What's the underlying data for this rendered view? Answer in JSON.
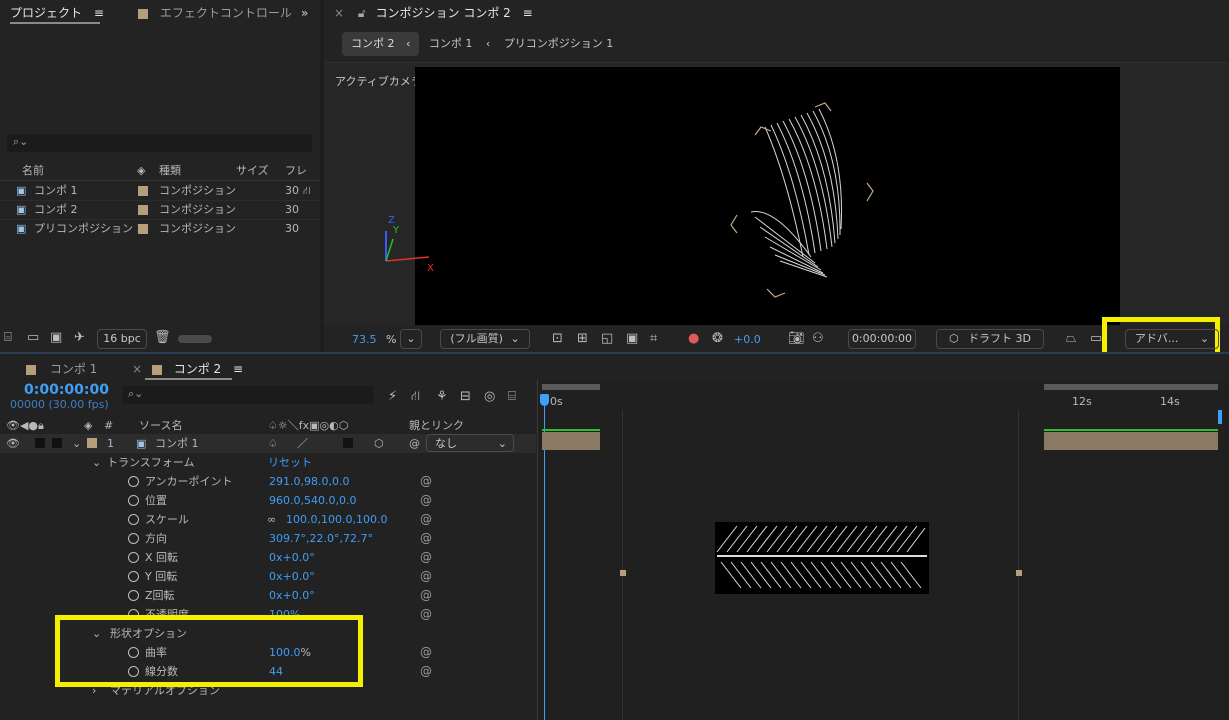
{
  "project_panel": {
    "tab_project": "プロジェクト",
    "tab_effects": "エフェクトコントロール",
    "columns": {
      "name": "名前",
      "type": "種類",
      "size": "サイズ",
      "frame": "フレ"
    },
    "items": [
      {
        "name": "コンポ 1",
        "type": "コンポジション",
        "frame": "30"
      },
      {
        "name": "コンポ 2",
        "type": "コンポジション",
        "frame": "30"
      },
      {
        "name": "プリコンポジション 1",
        "type": "コンポジション",
        "frame": "30"
      }
    ],
    "bpc": "16 bpc"
  },
  "comp_panel": {
    "title": "コンポジション コンポ 2",
    "breadcrumbs": [
      "コンポ 2",
      "コンポ 1",
      "プリコンポジション 1"
    ],
    "camera_label": "アクティブカメラ (デフォルト)",
    "axis_labels": {
      "x": "X",
      "y": "Y",
      "z": "Z"
    },
    "zoom": "73.5",
    "zoom_unit": "%",
    "quality": "(フル画質)",
    "exposure": "+0.0",
    "timecode": "0:00:00:00",
    "renderer": "ドラフト 3D",
    "view_dropdown": "アドバ..."
  },
  "timeline": {
    "tabs": [
      "コンポ 1",
      "コンポ 2"
    ],
    "timecode": "0:00:00:00",
    "frame_info": "00000 (30.00 fps)",
    "col_source": "ソース名",
    "col_parent": "親とリンク",
    "col_hash": "#",
    "layer": {
      "num": "1",
      "name": "コンポ 1",
      "parent": "なし"
    },
    "transform_label": "トランスフォーム",
    "reset_label": "リセット",
    "props": [
      {
        "name": "アンカーポイント",
        "value": "291.0,98.0,0.0"
      },
      {
        "name": "位置",
        "value": "960.0,540.0,0.0"
      },
      {
        "name": "スケール",
        "value": "100.0,100.0,100.0"
      },
      {
        "name": "方向",
        "value": "309.7°,22.0°,72.7°"
      },
      {
        "name": "X 回転",
        "value": "0x+0.0°"
      },
      {
        "name": "Y 回転",
        "value": "0x+0.0°"
      },
      {
        "name": "Z回転",
        "value": "0x+0.0°"
      },
      {
        "name": "不透明度",
        "value": "100%"
      }
    ],
    "shape_options_label": "形状オプション",
    "shape_props": [
      {
        "name": "曲率",
        "value": "100.0",
        "unit": "%"
      },
      {
        "name": "線分数",
        "value": "44",
        "unit": ""
      }
    ],
    "material_label": "マテリアルオプション",
    "ruler": {
      "start": "0s",
      "mark1": "12s",
      "mark2": "14s"
    }
  },
  "colors": {
    "accent": "#3f9ef5",
    "highlight": "#f5f000",
    "label_tan": "#b59d7e"
  }
}
